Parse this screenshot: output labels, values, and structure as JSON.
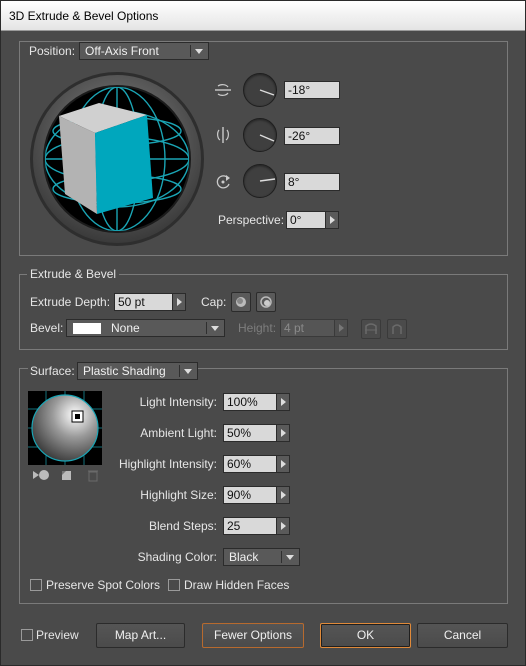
{
  "window": {
    "title": "3D Extrude & Bevel Options"
  },
  "position": {
    "label": "Position:",
    "preset": "Off-Axis Front",
    "rot_x": "-18°",
    "rot_y": "-26°",
    "rot_z": "8°",
    "perspective_label": "Perspective:",
    "perspective": "0°"
  },
  "extrude": {
    "section_label": "Extrude & Bevel",
    "depth_label": "Extrude Depth:",
    "depth": "50 pt",
    "cap_label": "Cap:",
    "bevel_label": "Bevel:",
    "bevel": "None",
    "height_label": "Height:",
    "height": "4 pt"
  },
  "surface": {
    "label": "Surface:",
    "type": "Plastic Shading",
    "light_intensity_label": "Light Intensity:",
    "light_intensity": "100%",
    "ambient_light_label": "Ambient Light:",
    "ambient_light": "50%",
    "highlight_intensity_label": "Highlight Intensity:",
    "highlight_intensity": "60%",
    "highlight_size_label": "Highlight Size:",
    "highlight_size": "90%",
    "blend_steps_label": "Blend Steps:",
    "blend_steps": "25",
    "shading_color_label": "Shading Color:",
    "shading_color": "Black",
    "preserve_spot_label": "Preserve Spot Colors",
    "draw_hidden_label": "Draw Hidden Faces"
  },
  "footer": {
    "preview_label": "Preview",
    "map_art": "Map Art...",
    "fewer_options": "Fewer Options",
    "ok": "OK",
    "cancel": "Cancel"
  },
  "colors": {
    "cube_front": "#00a7bd",
    "cube_side": "#b3b3b3",
    "cube_top": "#d0d0d0",
    "grid": "#1aa5b5",
    "focus_border": "#e08a3a"
  }
}
